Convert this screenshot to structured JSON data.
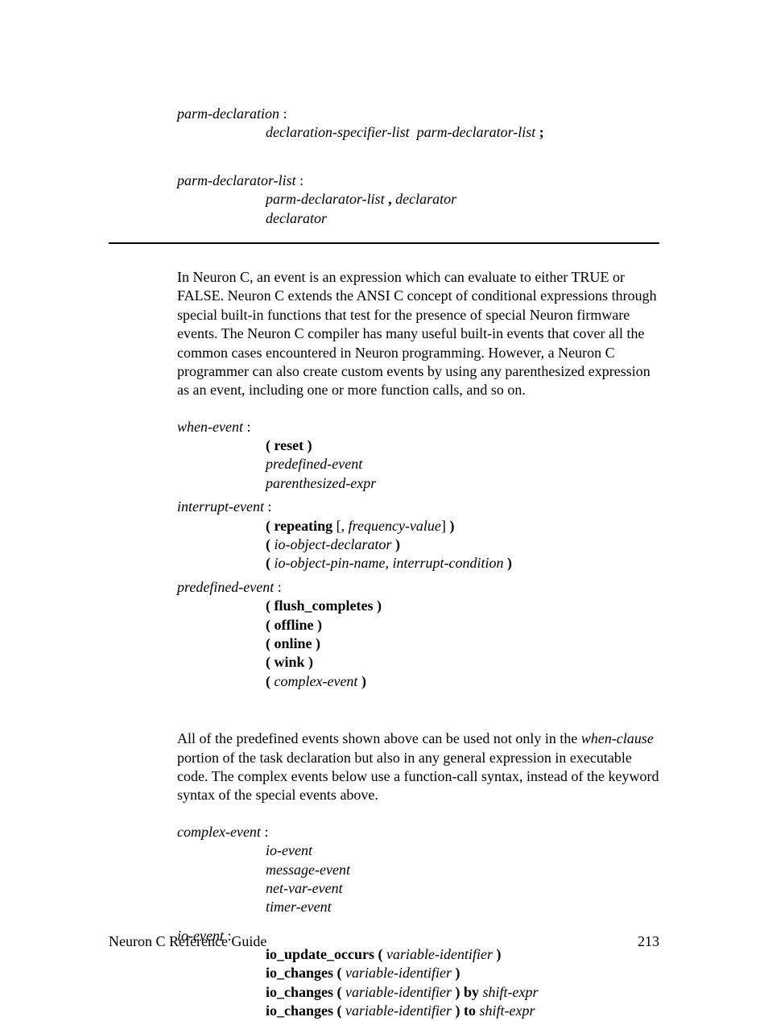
{
  "parm_decl": {
    "label": "parm-declaration",
    "line1_a": "declaration-specifier-list",
    "line1_b": "parm-declarator-list",
    "line1_semi": ";"
  },
  "parm_decl_list": {
    "label": "parm-declarator-list",
    "line1_a": "parm-declarator-list",
    "line1_comma": " , ",
    "line1_b": "declarator",
    "line2": "declarator"
  },
  "para1": "In Neuron C, an event is an expression which can evaluate to either TRUE or FALSE.  Neuron C extends the ANSI C concept of conditional expressions through special built-in functions that test for the presence of special Neuron firmware events.  The Neuron C compiler has many useful built-in events that cover all the common cases encountered in Neuron programming.  However, a Neuron C programmer can also create custom events by using any parenthesized expression as an event, including one or more function calls, and so on.",
  "when_event": {
    "label": "when-event",
    "l1": "( reset )",
    "l2": "predefined-event",
    "l3": "parenthesized-expr"
  },
  "interrupt_event": {
    "label": "interrupt-event",
    "l1_a": "( repeating",
    "l1_b": " [, ",
    "l1_c": "frequency-value",
    "l1_d": "] ",
    "l1_e": ")",
    "l2_a": "(",
    "l2_b": " io-object-declarator ",
    "l2_c": ")",
    "l3_a": "(",
    "l3_b": " io-object-pin-name, interrupt-condition ",
    "l3_c": ")"
  },
  "predefined_event": {
    "label": "predefined-event",
    "l1": "( flush_completes )",
    "l2": "( offline )",
    "l3": "( online )",
    "l4": "( wink )",
    "l5_a": "(",
    "l5_b": " complex-event ",
    "l5_c": ")"
  },
  "para2_pre": "All of the predefined events shown above can be used not only in the ",
  "para2_ital": "when-clause",
  "para2_post": " portion of the task declaration but also in any general expression in executable code.  The complex events below use a function-call syntax, instead of the keyword syntax of the special events above.",
  "complex_event": {
    "label": "complex-event",
    "l1": "io-event",
    "l2": "message-event",
    "l3": "net-var-event",
    "l4": "timer-event"
  },
  "io_event": {
    "label": "io-event",
    "l1_a": "io_update_occurs (",
    "l1_b": " variable-identifier ",
    "l1_c": ")",
    "l2_a": "io_changes (",
    "l2_b": " variable-identifier ",
    "l2_c": ")",
    "l3_a": "io_changes (",
    "l3_b": " variable-identifier ",
    "l3_c": ") by",
    "l3_d": " shift-expr",
    "l4_a": "io_changes (",
    "l4_b": " variable-identifier ",
    "l4_c": ") to",
    "l4_d": " shift-expr"
  },
  "footer": {
    "left": "Neuron C Reference Guide",
    "right": "213"
  }
}
